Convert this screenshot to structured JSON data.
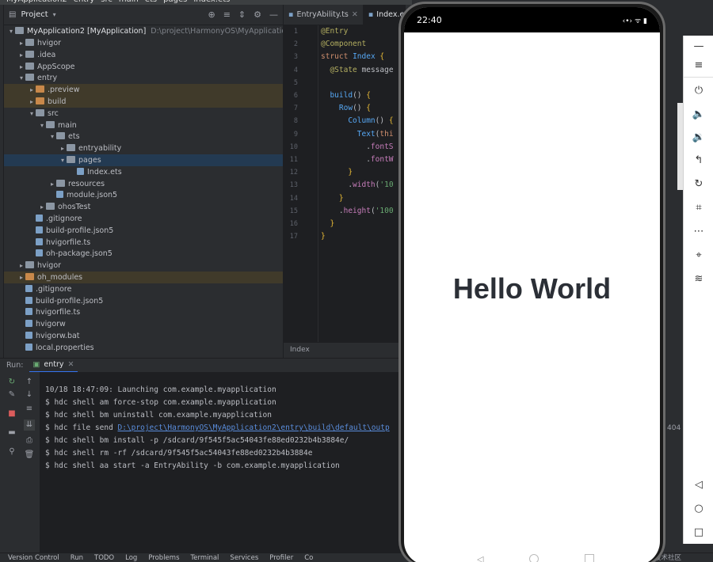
{
  "breadcrumb": [
    "MyApplication2",
    "entry",
    "src",
    "main",
    "ets",
    "pages",
    "Index.ets"
  ],
  "project": {
    "title": "Project",
    "root_name": "MyApplication2 [MyApplication]",
    "root_path": "D:\\project\\HarmonyOS\\MyApplication",
    "tree": [
      {
        "label": "hvigor",
        "depth": 1,
        "arrow": "▸",
        "kind": "folder"
      },
      {
        "label": ".idea",
        "depth": 1,
        "arrow": "▸",
        "kind": "folder"
      },
      {
        "label": "AppScope",
        "depth": 1,
        "arrow": "▸",
        "kind": "folder"
      },
      {
        "label": "entry",
        "depth": 1,
        "arrow": "▾",
        "kind": "folder"
      },
      {
        "label": ".preview",
        "depth": 2,
        "arrow": "▸",
        "kind": "orange",
        "state": "hl"
      },
      {
        "label": "build",
        "depth": 2,
        "arrow": "▸",
        "kind": "orange",
        "state": "hl"
      },
      {
        "label": "src",
        "depth": 2,
        "arrow": "▾",
        "kind": "folder"
      },
      {
        "label": "main",
        "depth": 3,
        "arrow": "▾",
        "kind": "folder"
      },
      {
        "label": "ets",
        "depth": 4,
        "arrow": "▾",
        "kind": "folder"
      },
      {
        "label": "entryability",
        "depth": 5,
        "arrow": "▸",
        "kind": "folder"
      },
      {
        "label": "pages",
        "depth": 5,
        "arrow": "▾",
        "kind": "folder",
        "state": "sel"
      },
      {
        "label": "Index.ets",
        "depth": 6,
        "arrow": "",
        "kind": "file"
      },
      {
        "label": "resources",
        "depth": 4,
        "arrow": "▸",
        "kind": "folder"
      },
      {
        "label": "module.json5",
        "depth": 4,
        "arrow": "",
        "kind": "file"
      },
      {
        "label": "ohosTest",
        "depth": 3,
        "arrow": "▸",
        "kind": "folder"
      },
      {
        "label": ".gitignore",
        "depth": 2,
        "arrow": "",
        "kind": "file"
      },
      {
        "label": "build-profile.json5",
        "depth": 2,
        "arrow": "",
        "kind": "file"
      },
      {
        "label": "hvigorfile.ts",
        "depth": 2,
        "arrow": "",
        "kind": "file"
      },
      {
        "label": "oh-package.json5",
        "depth": 2,
        "arrow": "",
        "kind": "file"
      },
      {
        "label": "hvigor",
        "depth": 1,
        "arrow": "▸",
        "kind": "folder"
      },
      {
        "label": "oh_modules",
        "depth": 1,
        "arrow": "▸",
        "kind": "orange",
        "state": "hl"
      },
      {
        "label": ".gitignore",
        "depth": 1,
        "arrow": "",
        "kind": "file"
      },
      {
        "label": "build-profile.json5",
        "depth": 1,
        "arrow": "",
        "kind": "file"
      },
      {
        "label": "hvigorfile.ts",
        "depth": 1,
        "arrow": "",
        "kind": "file"
      },
      {
        "label": "hvigorw",
        "depth": 1,
        "arrow": "",
        "kind": "file"
      },
      {
        "label": "hvigorw.bat",
        "depth": 1,
        "arrow": "",
        "kind": "file"
      },
      {
        "label": "local.properties",
        "depth": 1,
        "arrow": "",
        "kind": "file"
      }
    ]
  },
  "editor": {
    "tabs": [
      "EntryAbility.ts",
      "Index.ets"
    ],
    "active_tab": 1,
    "status_label": "Index",
    "lines": [
      {
        "n": "1",
        "html": "<span class='ann'>@Entry</span>"
      },
      {
        "n": "2",
        "html": "<span class='ann'>@Component</span>"
      },
      {
        "n": "3",
        "html": "<span class='kw'>struct</span> <span class='cls'>Index</span> <span class='paren'>{</span>"
      },
      {
        "n": "4",
        "html": "  <span class='ann'>@State</span> message"
      },
      {
        "n": "5",
        "html": ""
      },
      {
        "n": "6",
        "html": "  <span class='fn'>build</span>() <span class='paren'>{</span>"
      },
      {
        "n": "7",
        "html": "    <span class='fn'>Row</span>() <span class='paren'>{</span>"
      },
      {
        "n": "8",
        "html": "      <span class='fn'>Column</span>() <span class='paren'>{</span>"
      },
      {
        "n": "9",
        "html": "        <span class='fn'>Text</span>(<span class='kw'>thi</span>"
      },
      {
        "n": "10",
        "html": "          .<span class='prop'>fontS</span>"
      },
      {
        "n": "11",
        "html": "          .<span class='prop'>fontW</span>"
      },
      {
        "n": "12",
        "html": "      <span class='paren'>}</span>"
      },
      {
        "n": "13",
        "html": "      .<span class='prop'>width</span>(<span class='str'>'10</span>"
      },
      {
        "n": "14",
        "html": "    <span class='paren'>}</span>"
      },
      {
        "n": "15",
        "html": "    .<span class='prop'>height</span>(<span class='str'>'100</span>"
      },
      {
        "n": "16",
        "html": "  <span class='paren'>}</span>"
      },
      {
        "n": "17",
        "html": "<span class='paren'>}</span>"
      }
    ]
  },
  "run": {
    "label": "Run:",
    "tab": "entry",
    "console": [
      "10/18 18:47:09: Launching com.example.myapplication",
      "$ hdc shell am force-stop com.example.myapplication",
      "$ hdc shell bm uninstall com.example.myapplication",
      "$ hdc file send D:\\project\\HarmonyOS\\MyApplication2\\entry\\build\\default\\outp",
      "$ hdc shell bm install -p /sdcard/9f545f5ac54043fe88ed0232b4b3884e/",
      "$ hdc shell rm -rf /sdcard/9f545f5ac54043fe88ed0232b4b3884e",
      "$ hdc shell aa start -a EntryAbility -b com.example.myapplication"
    ],
    "send_prefix": "$ hdc file send ",
    "send_link": "D:\\project\\HarmonyOS\\MyApplication2\\entry\\build\\default\\outp"
  },
  "statusbar": {
    "items": [
      "Version Control",
      "Run",
      "TODO",
      "Log",
      "Problems",
      "Terminal",
      "Services",
      "Profiler",
      "Co"
    ],
    "right": "@稀土掘金技术社区",
    "peek": "404"
  },
  "phone": {
    "time": "22:40",
    "status_icons": "‹•› ᯤ ▮",
    "text": "Hello World"
  },
  "colors": {
    "accent": "#3574f0",
    "ide_bg": "#2b2d30",
    "editor_bg": "#1e1f22",
    "hello_text": "#2b2f36"
  }
}
